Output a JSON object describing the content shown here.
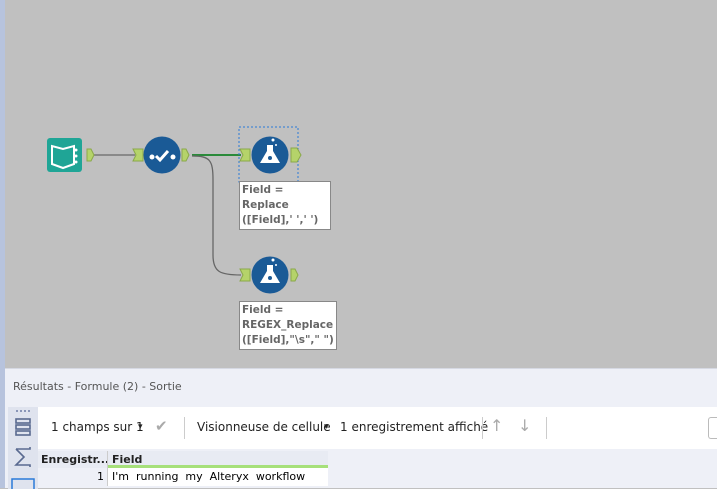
{
  "canvas": {
    "tools": [
      {
        "name": "input",
        "icon": "book-input-icon",
        "color": "#1fa596"
      },
      {
        "name": "select",
        "icon": "select-check-icon",
        "color": "#1a5a96"
      },
      {
        "name": "formula-1",
        "icon": "flask-icon",
        "color": "#1a5a96",
        "annotation": [
          "Field = Replace",
          "([Field],' ',' ')"
        ]
      },
      {
        "name": "formula-2",
        "icon": "flask-icon",
        "color": "#1a5a96",
        "annotation": [
          "Field =",
          "REGEX_Replace",
          "([Field],\"\\s\",\"  \")"
        ]
      }
    ]
  },
  "results": {
    "title": "Résultats - Formule (2) - Sortie",
    "fields_label": "1 champs sur 1",
    "viewer_label": "Visionneuse de cellule",
    "records_label": "1 enregistrement affiché",
    "columns": [
      "Enregistr...",
      "Field"
    ],
    "rows": [
      {
        "record": "1",
        "field": "I'm  running  my  Alteryx  workflow"
      }
    ]
  },
  "colors": {
    "accent_green": "#a6e07a",
    "connector": "#b5d36a"
  }
}
